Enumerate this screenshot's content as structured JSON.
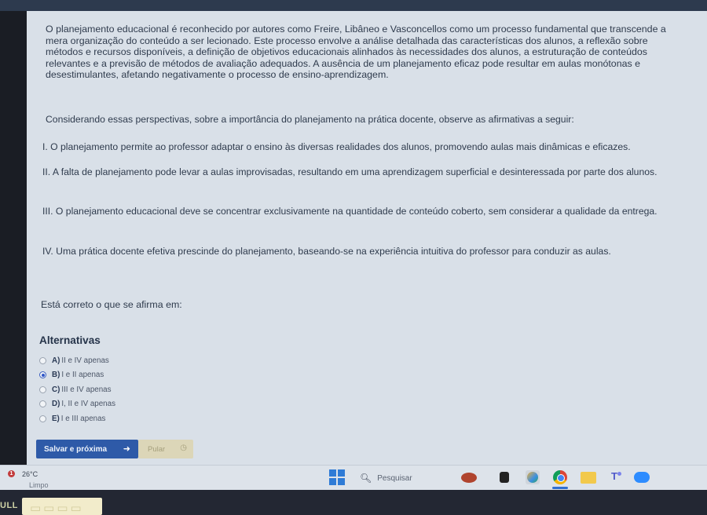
{
  "passage": "O planejamento educacional é reconhecido por autores como Freire, Libâneo e Vasconcellos como um processo fundamental que transcende a mera organização do conteúdo a ser lecionado. Este processo envolve a análise detalhada das características dos alunos, a reflexão sobre métodos e recursos disponíveis, a definição de objetivos educacionais alinhados às necessidades dos alunos, a estruturação de conteúdos relevantes e a previsão de métodos de avaliação adequados. A ausência de um planejamento eficaz pode resultar em aulas monótonas e desestimulantes, afetando negativamente o processo de ensino-aprendizagem.",
  "prompt": "Considerando essas perspectivas, sobre a importância do planejamento na prática docente, observe as afirmativas a seguir:",
  "statements": [
    "I. O planejamento permite ao professor adaptar o ensino às diversas realidades dos alunos, promovendo aulas mais dinâmicas e eficazes.",
    "II. A falta de planejamento pode levar a aulas improvisadas, resultando em uma aprendizagem superficial e desinteressada por parte dos alunos.",
    "III. O planejamento educacional deve se concentrar exclusivamente na quantidade de conteúdo coberto, sem considerar a qualidade da entrega.",
    "IV. Uma prática docente efetiva prescinde do planejamento, baseando-se na experiência intuitiva do professor para conduzir as aulas."
  ],
  "question": "Está correto o que se afirma em:",
  "alternatives_title": "Alternativas",
  "alternatives": [
    {
      "letter": "A)",
      "text": "II e IV apenas",
      "selected": false
    },
    {
      "letter": "B)",
      "text": "I e II apenas",
      "selected": true
    },
    {
      "letter": "C)",
      "text": "III e IV apenas",
      "selected": false
    },
    {
      "letter": "D)",
      "text": "I, II e IV apenas",
      "selected": false
    },
    {
      "letter": "E)",
      "text": "I e III apenas",
      "selected": false
    }
  ],
  "buttons": {
    "save_next": "Salvar e próxima",
    "skip": "Pular"
  },
  "taskbar": {
    "weather_badge": "1",
    "weather_temp": "26°C",
    "weather_desc": "Limpo",
    "search_label": "Pesquisar"
  },
  "bezel": {
    "left_text": "ULL"
  },
  "icons": [
    "arrow-icon",
    "clock-icon",
    "windows-start-icon",
    "search-icon",
    "photos-icon",
    "chrome-icon",
    "file-explorer-icon",
    "teams-icon",
    "zoom-icon"
  ],
  "colors": {
    "accent": "#2e5aa8",
    "page_bg": "#d9e0e8",
    "text": "#2f3b4d"
  }
}
